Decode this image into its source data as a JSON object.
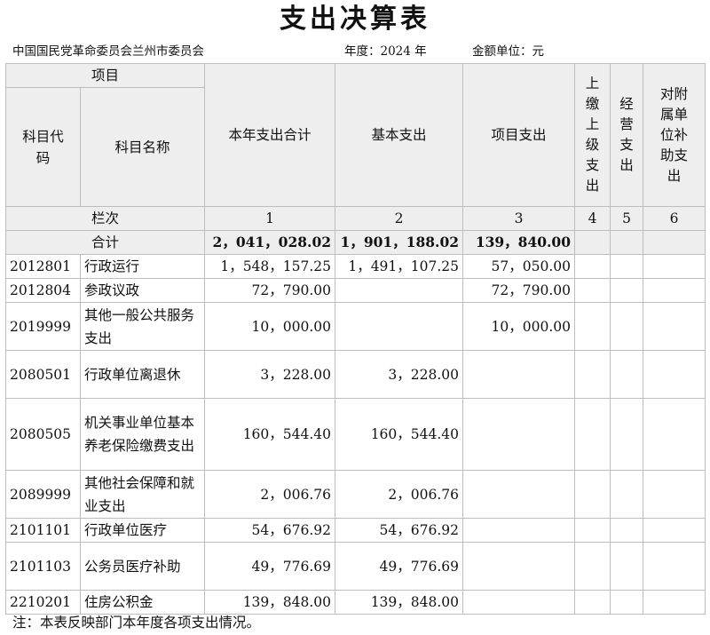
{
  "title": "支出决算表",
  "meta": {
    "org": "中国国民党革命委员会兰州市委员会",
    "year": "年度：2024 年",
    "unit": "金额单位：元"
  },
  "headers": {
    "project": "项目",
    "code": "科目代码",
    "name": "科目名称",
    "total": "本年支出合计",
    "basic": "基本支出",
    "project_exp": "项目支出",
    "upper": "上缴上级支出",
    "business": "经营支出",
    "subsidy": "对附属单位补助支出",
    "column_no": "栏次",
    "col1": "1",
    "col2": "2",
    "col3": "3",
    "col4": "4",
    "col5": "5",
    "col6": "6"
  },
  "sum_row": {
    "label": "合计",
    "total": "2，041，028.02",
    "basic": "1，901，188.02",
    "project": "139，840.00"
  },
  "rows": [
    {
      "code": "2012801",
      "name": "行政运行",
      "total": "1，548，157.25",
      "basic": "1，491，107.25",
      "project": "57，050.00"
    },
    {
      "code": "2012804",
      "name": "参政议政",
      "total": "72，790.00",
      "basic": "",
      "project": "72，790.00"
    },
    {
      "code": "2019999",
      "name": "其他一般公共服务支出",
      "total": "10，000.00",
      "basic": "",
      "project": "10，000.00"
    },
    {
      "code": "2080501",
      "name": "行政单位离退休",
      "total": "3，228.00",
      "basic": "3，228.00",
      "project": ""
    },
    {
      "code": "2080505",
      "name": "机关事业单位基本养老保险缴费支出",
      "total": "160，544.40",
      "basic": "160，544.40",
      "project": ""
    },
    {
      "code": "2089999",
      "name": "其他社会保障和就业支出",
      "total": "2，006.76",
      "basic": "2，006.76",
      "project": ""
    },
    {
      "code": "2101101",
      "name": "行政单位医疗",
      "total": "54，676.92",
      "basic": "54，676.92",
      "project": ""
    },
    {
      "code": "2101103",
      "name": "公务员医疗补助",
      "total": "49，776.69",
      "basic": "49，776.69",
      "project": ""
    },
    {
      "code": "2210201",
      "name": "住房公积金",
      "total": "139，848.00",
      "basic": "139，848.00",
      "project": ""
    }
  ],
  "note": "注：本表反映部门本年度各项支出情况。"
}
